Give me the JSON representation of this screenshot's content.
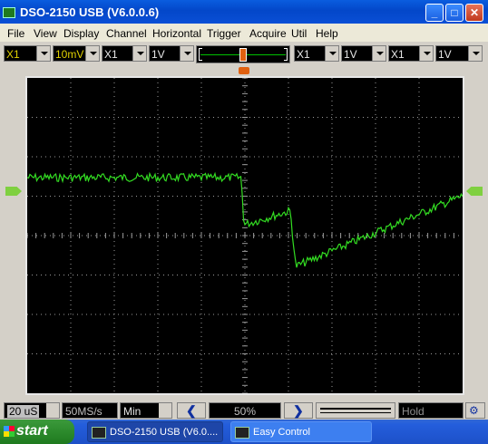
{
  "window": {
    "title": "DSO-2150 USB (V6.0.0.6)"
  },
  "menu": [
    "File",
    "View",
    "Display",
    "Channel",
    "Horizontal",
    "Trigger",
    "Acquire",
    "Util",
    "Help"
  ],
  "toolbar": {
    "ch1_probe": "X1",
    "ch1_volts": "10mV",
    "ch2_probe": "X1",
    "ch2_volts": "1V",
    "ext_probe1": "X1",
    "ext_volts1": "1V",
    "ext_probe2": "X1",
    "ext_volts2": "1V"
  },
  "status": {
    "timebase": "20 uS",
    "sample_rate": "50MS/s",
    "mode": "Min",
    "position": "50%",
    "run_state": "Hold"
  },
  "taskbar": {
    "start_label": "start",
    "tasks": [
      "DSO-2150 USB (V6.0....",
      "Easy Control"
    ]
  },
  "colors": {
    "trace": "#33dd22",
    "grid": "#9a9a9a",
    "screen": "#000000",
    "marker": "#e06010"
  },
  "icons": [
    "scope-app-icon",
    "minimize-icon",
    "maximize-icon",
    "close-icon",
    "scroll-left-icon",
    "scroll-right-icon",
    "windows-flag-icon"
  ]
}
